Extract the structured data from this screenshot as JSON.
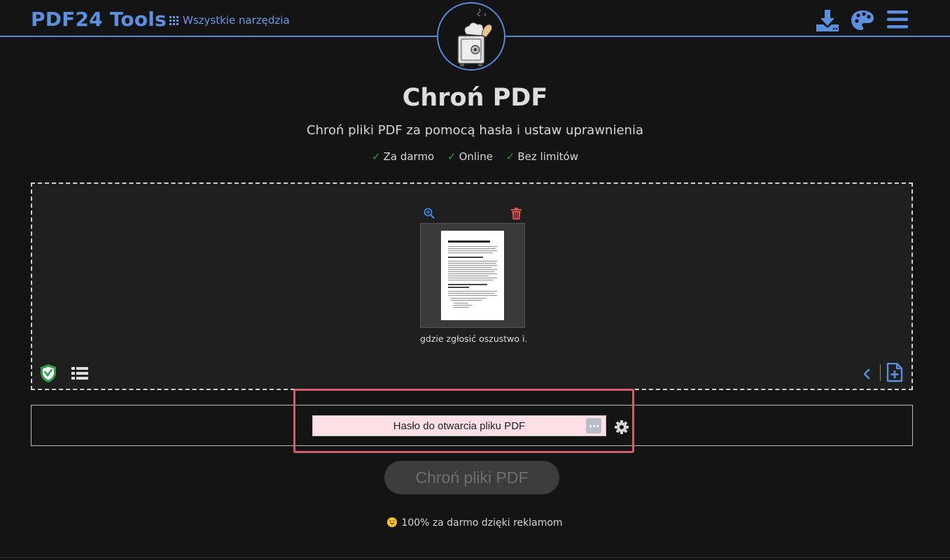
{
  "header": {
    "logo": "PDF24 Tools",
    "all_tools_label": "Wszystkie narzędzia"
  },
  "tool": {
    "title": "Chroń PDF",
    "subtitle": "Chroń pliki PDF za pomocą hasła i ustaw uprawnienia",
    "features": [
      "Za darmo",
      "Online",
      "Bez limitów"
    ]
  },
  "file": {
    "name": "gdzie zgłosić oszustwo i..."
  },
  "password": {
    "placeholder": "Hasło do otwarcia pliku PDF",
    "value": ""
  },
  "submit_label": "Chroń pliki PDF",
  "footer_note": "100% za darmo dzięki reklamom",
  "colors": {
    "accent": "#5b8fe0",
    "highlight": "#d45d6c",
    "check": "#2ea043",
    "danger": "#d9534f"
  },
  "icons": {
    "header": [
      "download-icon",
      "palette-icon",
      "menu-icon"
    ],
    "file": [
      "zoom-in-icon",
      "trash-icon"
    ],
    "dropzone": [
      "shield-check-icon",
      "list-icon",
      "chevron-left-icon",
      "add-file-icon"
    ],
    "options": [
      "password-manager-icon",
      "gear-icon"
    ]
  }
}
